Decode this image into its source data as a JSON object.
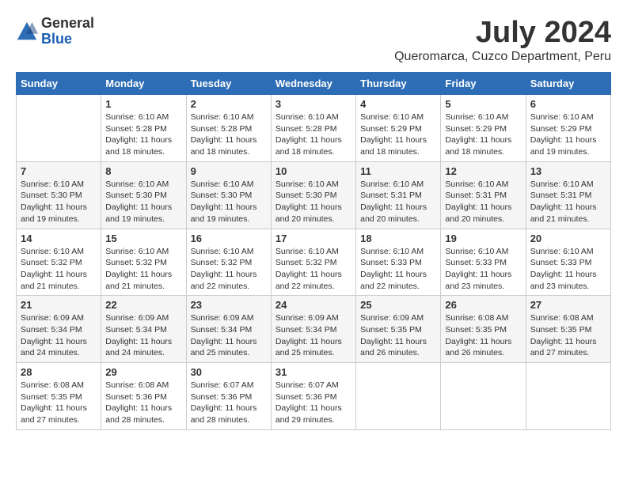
{
  "header": {
    "logo_general": "General",
    "logo_blue": "Blue",
    "month_year": "July 2024",
    "location": "Queromarca, Cuzco Department, Peru"
  },
  "calendar": {
    "days_of_week": [
      "Sunday",
      "Monday",
      "Tuesday",
      "Wednesday",
      "Thursday",
      "Friday",
      "Saturday"
    ],
    "weeks": [
      [
        {
          "day": "",
          "info": ""
        },
        {
          "day": "1",
          "info": "Sunrise: 6:10 AM\nSunset: 5:28 PM\nDaylight: 11 hours\nand 18 minutes."
        },
        {
          "day": "2",
          "info": "Sunrise: 6:10 AM\nSunset: 5:28 PM\nDaylight: 11 hours\nand 18 minutes."
        },
        {
          "day": "3",
          "info": "Sunrise: 6:10 AM\nSunset: 5:28 PM\nDaylight: 11 hours\nand 18 minutes."
        },
        {
          "day": "4",
          "info": "Sunrise: 6:10 AM\nSunset: 5:29 PM\nDaylight: 11 hours\nand 18 minutes."
        },
        {
          "day": "5",
          "info": "Sunrise: 6:10 AM\nSunset: 5:29 PM\nDaylight: 11 hours\nand 18 minutes."
        },
        {
          "day": "6",
          "info": "Sunrise: 6:10 AM\nSunset: 5:29 PM\nDaylight: 11 hours\nand 19 minutes."
        }
      ],
      [
        {
          "day": "7",
          "info": "Sunrise: 6:10 AM\nSunset: 5:30 PM\nDaylight: 11 hours\nand 19 minutes."
        },
        {
          "day": "8",
          "info": "Sunrise: 6:10 AM\nSunset: 5:30 PM\nDaylight: 11 hours\nand 19 minutes."
        },
        {
          "day": "9",
          "info": "Sunrise: 6:10 AM\nSunset: 5:30 PM\nDaylight: 11 hours\nand 19 minutes."
        },
        {
          "day": "10",
          "info": "Sunrise: 6:10 AM\nSunset: 5:30 PM\nDaylight: 11 hours\nand 20 minutes."
        },
        {
          "day": "11",
          "info": "Sunrise: 6:10 AM\nSunset: 5:31 PM\nDaylight: 11 hours\nand 20 minutes."
        },
        {
          "day": "12",
          "info": "Sunrise: 6:10 AM\nSunset: 5:31 PM\nDaylight: 11 hours\nand 20 minutes."
        },
        {
          "day": "13",
          "info": "Sunrise: 6:10 AM\nSunset: 5:31 PM\nDaylight: 11 hours\nand 21 minutes."
        }
      ],
      [
        {
          "day": "14",
          "info": "Sunrise: 6:10 AM\nSunset: 5:32 PM\nDaylight: 11 hours\nand 21 minutes."
        },
        {
          "day": "15",
          "info": "Sunrise: 6:10 AM\nSunset: 5:32 PM\nDaylight: 11 hours\nand 21 minutes."
        },
        {
          "day": "16",
          "info": "Sunrise: 6:10 AM\nSunset: 5:32 PM\nDaylight: 11 hours\nand 22 minutes."
        },
        {
          "day": "17",
          "info": "Sunrise: 6:10 AM\nSunset: 5:32 PM\nDaylight: 11 hours\nand 22 minutes."
        },
        {
          "day": "18",
          "info": "Sunrise: 6:10 AM\nSunset: 5:33 PM\nDaylight: 11 hours\nand 22 minutes."
        },
        {
          "day": "19",
          "info": "Sunrise: 6:10 AM\nSunset: 5:33 PM\nDaylight: 11 hours\nand 23 minutes."
        },
        {
          "day": "20",
          "info": "Sunrise: 6:10 AM\nSunset: 5:33 PM\nDaylight: 11 hours\nand 23 minutes."
        }
      ],
      [
        {
          "day": "21",
          "info": "Sunrise: 6:09 AM\nSunset: 5:34 PM\nDaylight: 11 hours\nand 24 minutes."
        },
        {
          "day": "22",
          "info": "Sunrise: 6:09 AM\nSunset: 5:34 PM\nDaylight: 11 hours\nand 24 minutes."
        },
        {
          "day": "23",
          "info": "Sunrise: 6:09 AM\nSunset: 5:34 PM\nDaylight: 11 hours\nand 25 minutes."
        },
        {
          "day": "24",
          "info": "Sunrise: 6:09 AM\nSunset: 5:34 PM\nDaylight: 11 hours\nand 25 minutes."
        },
        {
          "day": "25",
          "info": "Sunrise: 6:09 AM\nSunset: 5:35 PM\nDaylight: 11 hours\nand 26 minutes."
        },
        {
          "day": "26",
          "info": "Sunrise: 6:08 AM\nSunset: 5:35 PM\nDaylight: 11 hours\nand 26 minutes."
        },
        {
          "day": "27",
          "info": "Sunrise: 6:08 AM\nSunset: 5:35 PM\nDaylight: 11 hours\nand 27 minutes."
        }
      ],
      [
        {
          "day": "28",
          "info": "Sunrise: 6:08 AM\nSunset: 5:35 PM\nDaylight: 11 hours\nand 27 minutes."
        },
        {
          "day": "29",
          "info": "Sunrise: 6:08 AM\nSunset: 5:36 PM\nDaylight: 11 hours\nand 28 minutes."
        },
        {
          "day": "30",
          "info": "Sunrise: 6:07 AM\nSunset: 5:36 PM\nDaylight: 11 hours\nand 28 minutes."
        },
        {
          "day": "31",
          "info": "Sunrise: 6:07 AM\nSunset: 5:36 PM\nDaylight: 11 hours\nand 29 minutes."
        },
        {
          "day": "",
          "info": ""
        },
        {
          "day": "",
          "info": ""
        },
        {
          "day": "",
          "info": ""
        }
      ]
    ]
  }
}
